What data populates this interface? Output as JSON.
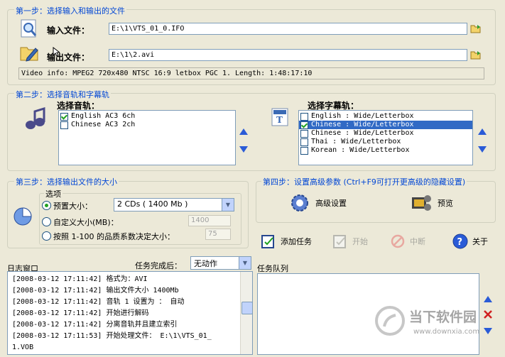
{
  "step1": {
    "title": "第一步：选择输入和输出的文件",
    "input_label": "输入文件：",
    "input_value": "E:\\1\\VTS_01_0.IFO",
    "output_label": "输出文件：",
    "output_value": "E:\\1\\2.avi",
    "video_info": "Video info: MPEG2 720x480 NTSC 16:9 letbox  PGC 1. Length: 1:48:17:10"
  },
  "step2": {
    "title": "第二步：选择音轨和字幕轨",
    "audio_label": "选择音轨：",
    "audio_tracks": [
      {
        "label": "English AC3 6ch",
        "checked": true
      },
      {
        "label": "Chinese AC3 2ch",
        "checked": false
      }
    ],
    "subtitle_label": "选择字幕轨：",
    "subtitle_tracks": [
      {
        "label": "English : Wide/Letterbox",
        "checked": false,
        "selected": false
      },
      {
        "label": "Chinese : Wide/Letterbox",
        "checked": true,
        "selected": true
      },
      {
        "label": "Chinese : Wide/Letterbox",
        "checked": false,
        "selected": false
      },
      {
        "label": "Thai : Wide/Letterbox",
        "checked": false,
        "selected": false
      },
      {
        "label": "Korean : Wide/Letterbox",
        "checked": false,
        "selected": false
      }
    ]
  },
  "step3": {
    "title": "第三步：选择输出文件的大小",
    "options_label": "选项",
    "preset_label": "预置大小：",
    "preset_value": "2 CDs ( 1400 Mb )",
    "custom_label": "自定义大小(MB)：",
    "custom_value": "1400",
    "quality_label": "按照 1-100 的品质系数决定大小：",
    "quality_value": "75"
  },
  "step4": {
    "title": "第四步：设置高级参数 (Ctrl+F9可打开更高级的隐藏设置)",
    "advanced_label": "高级设置",
    "preview_label": "预览"
  },
  "actions": {
    "add_task": "添加任务",
    "start": "开始",
    "stop": "中断",
    "about": "关于"
  },
  "log": {
    "title": "日志窗口",
    "after_label": "任务完成后：",
    "after_value": "无动作",
    "lines": [
      "[2008-03-12 17:11:42] 格式为：AVI",
      "[2008-03-12 17:11:42] 输出文件大小 1400Mb",
      "[2008-03-12 17:11:42] 音轨  1 设置为 ： 自动",
      "[2008-03-12 17:11:42] 开始进行解码",
      "[2008-03-12 17:11:42] 分离音轨并且建立索引",
      "[2008-03-12 17:11:53] 开始处理文件：    E:\\1\\VTS_01_",
      "1.VOB"
    ]
  },
  "queue": {
    "title": "任务队列"
  },
  "watermark": {
    "name": "当下软件园",
    "url": "www.downxia.com"
  },
  "colors": {
    "accent": "#2a5bd7",
    "group_title": "#0046d5",
    "selection": "#316ac5"
  }
}
